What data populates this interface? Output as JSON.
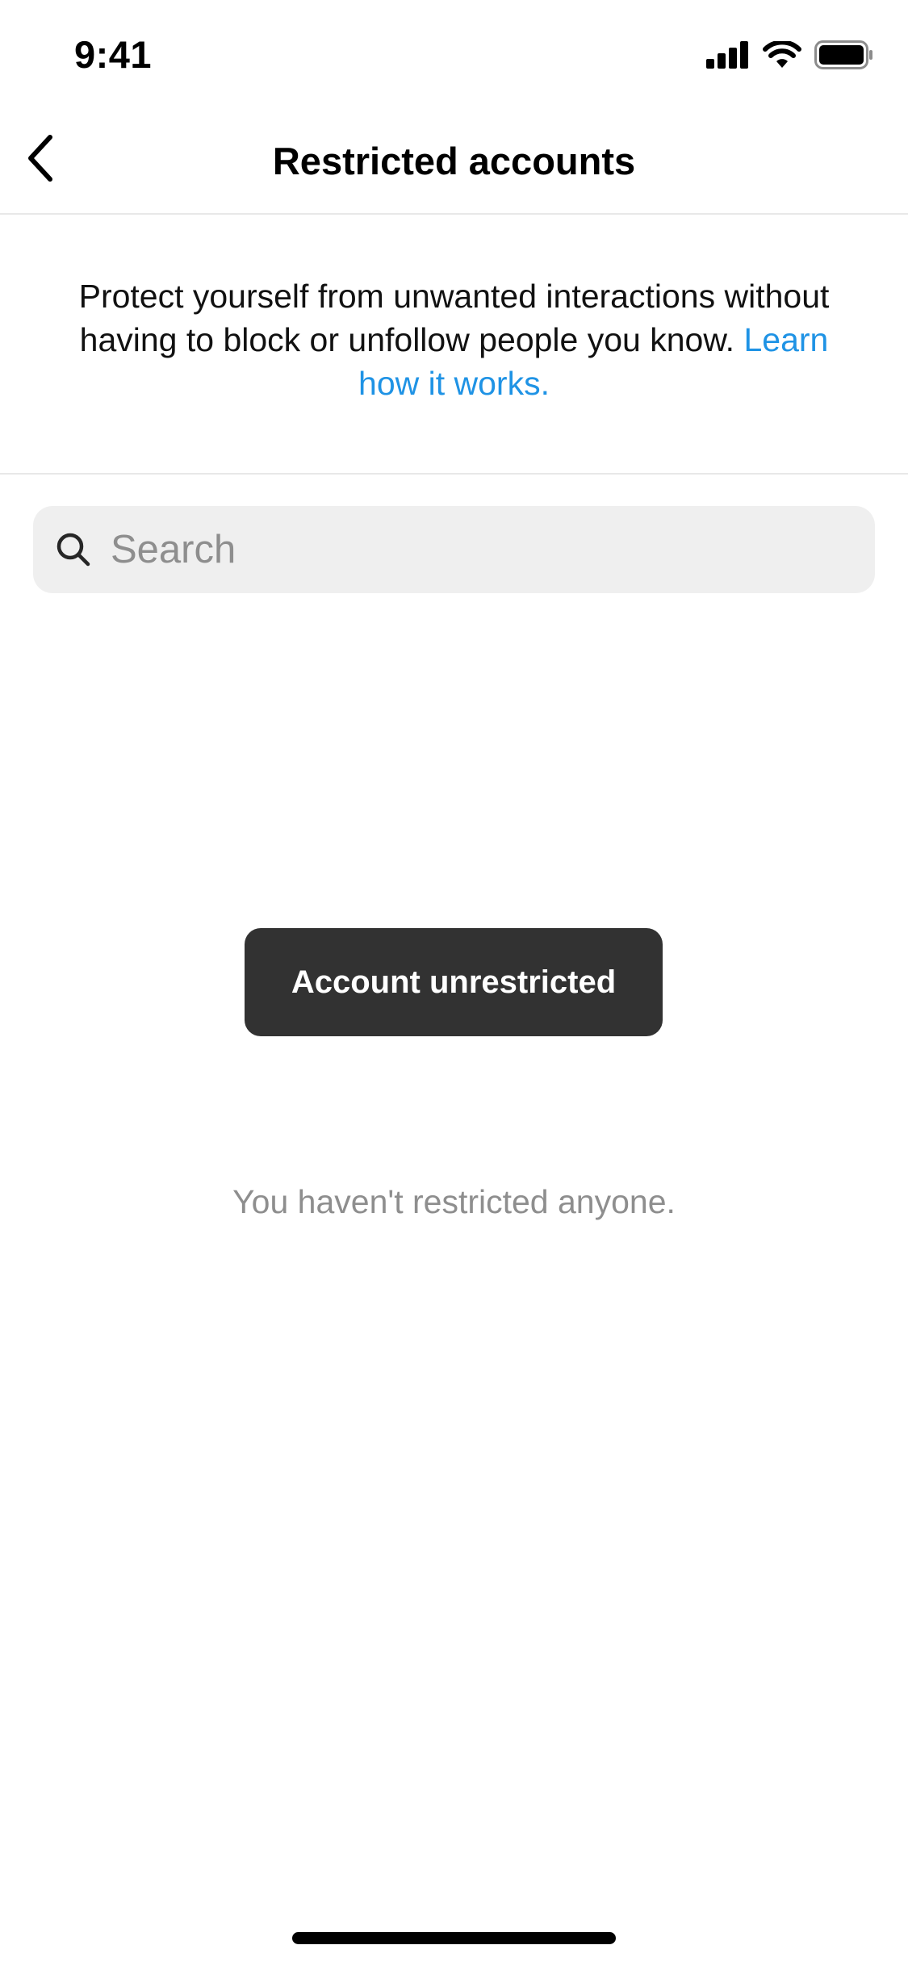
{
  "status_bar": {
    "time": "9:41",
    "icons": [
      "cellular-signal-icon",
      "wifi-icon",
      "battery-icon"
    ]
  },
  "header": {
    "title": "Restricted accounts",
    "back_icon": "chevron-left-icon"
  },
  "description": {
    "text": "Protect yourself from unwanted interactions without having to block or unfollow people you know. ",
    "link_text": "Learn how it works."
  },
  "search": {
    "placeholder": "Search",
    "value": "",
    "icon": "search-icon"
  },
  "toast": {
    "message": "Account unrestricted"
  },
  "empty_state": {
    "message": "You haven't restricted anyone."
  },
  "colors": {
    "link": "#1f93e5",
    "toast_bg": "#323232",
    "search_bg": "#efefef",
    "muted_text": "#8e8e8e"
  }
}
